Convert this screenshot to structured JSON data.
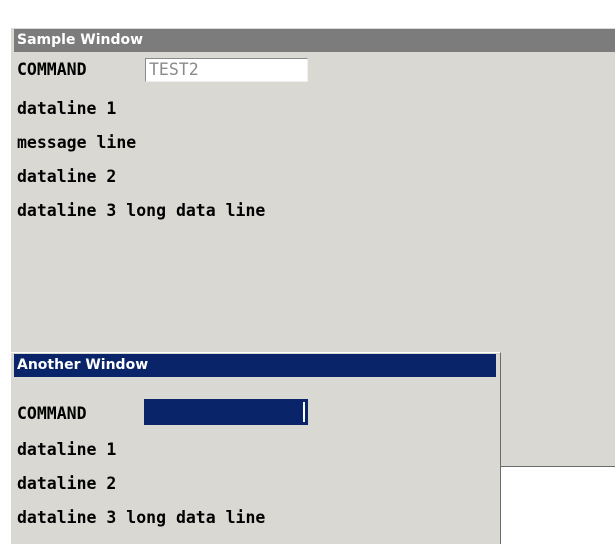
{
  "sample_window": {
    "title": "Sample Window",
    "command_label": "COMMAND",
    "command_value": "TEST2",
    "lines": [
      "dataline 1",
      "message line",
      "dataline 2",
      "dataline 3 long data line"
    ]
  },
  "another_window": {
    "title": "Another Window",
    "command_label": "COMMAND",
    "command_value": "",
    "lines": [
      "dataline 1",
      "dataline 2",
      "dataline 3 long data line"
    ]
  },
  "colors": {
    "window_bg": "#d9d8d2",
    "inactive_titlebar": "#7c7c7c",
    "active_titlebar": "#0a246a",
    "input_text_inactive": "#8a8a8a"
  }
}
